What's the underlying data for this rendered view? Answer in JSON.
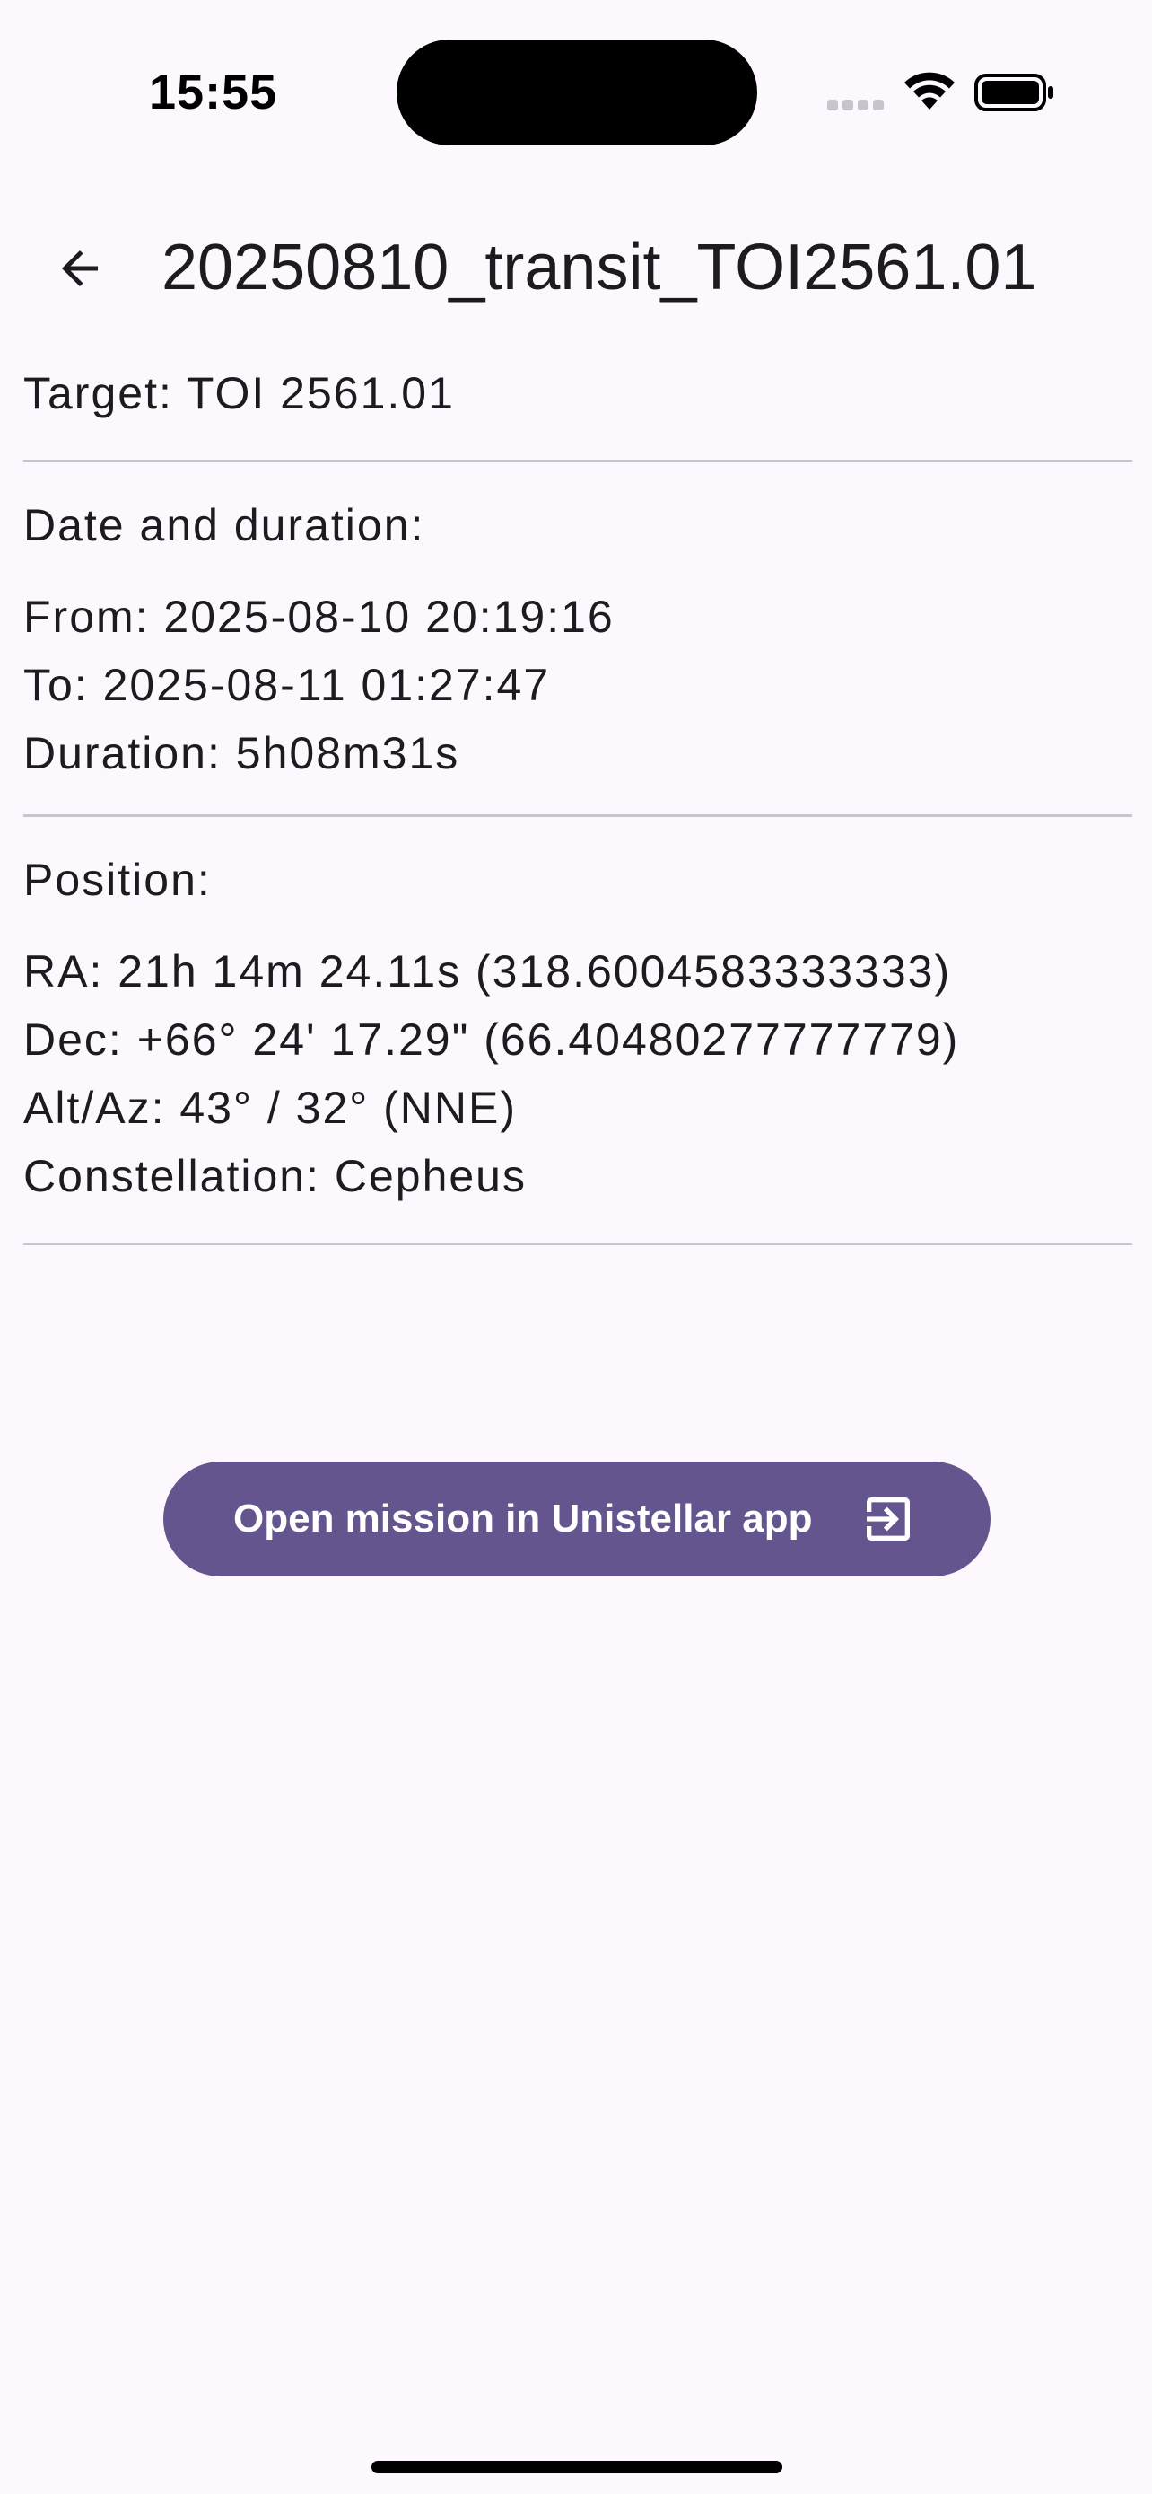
{
  "status_bar": {
    "time": "15:55"
  },
  "header": {
    "title": "20250810_transit_TOI2561.01",
    "back_icon": "arrow-left-icon"
  },
  "target": {
    "text": "Target: TOI 2561.01"
  },
  "date_section": {
    "heading": "Date and duration:",
    "from": "From: 2025-08-10 20:19:16",
    "to": "To: 2025-08-11 01:27:47",
    "duration": "Duration: 5h08m31s"
  },
  "position_section": {
    "heading": "Position:",
    "ra": "RA: 21h 14m 24.11s (318.6004583333333)",
    "dec": "Dec: +66° 24' 17.29\" (66.40480277777779)",
    "alt_az": "Alt/Az: 43° / 32° (NNE)",
    "constellation": "Constellation: Cepheus"
  },
  "actions": {
    "open_button_label": "Open mission in Unistellar app",
    "open_button_icon": "exit-to-app-icon"
  },
  "colors": {
    "background": "#fdf7fe",
    "primary": "#65558f",
    "divider": "#cac4cf",
    "text": "#1d1b20"
  }
}
